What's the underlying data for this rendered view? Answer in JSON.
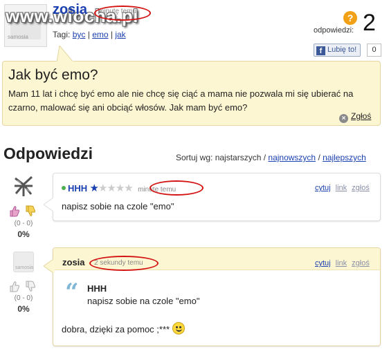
{
  "watermark": "www.wiocha.pl",
  "question": {
    "author": "zosia",
    "time": "minutę temu",
    "tags_label": "Tagi:",
    "tags": [
      "byc",
      "emo",
      "jak"
    ],
    "answers_label": "odpowiedzi:",
    "answers_count": "2",
    "fb_like_label": "Lubię to!",
    "fb_like_count": "0",
    "title": "Jak być emo?",
    "body": "Mam 11 lat i chcę być emo ale nie chcę się ciąć a mama nie pozwala mi się ubierać na czarno, malować się ani obciąć włosów. Jak mam być emo?",
    "report_label": "Zgłoś",
    "avatar_text": "samosia"
  },
  "answers_section": {
    "heading": "Odpowiedzi",
    "sort_label": "Sortuj wg: najstarszych /",
    "sort_options": [
      "najnowszych",
      "najlepszych"
    ]
  },
  "answers": [
    {
      "author": "HHH",
      "time": "minutę temu",
      "rating_stars": 1,
      "rating_max": 5,
      "body": "napisz sobie na czole \"emo\"",
      "actions": [
        "cytuj",
        "link",
        "zgłoś"
      ],
      "score_range": "(0 - 0)",
      "score_pct": "0%"
    },
    {
      "author": "zosia",
      "time": "2 sekundy temu",
      "quote_author": "HHH",
      "quote_text": "napisz sobie na czole \"emo\"",
      "body": "dobra, dzięki za pomoc ;***",
      "actions": [
        "cytuj",
        "link",
        "zgłoś"
      ],
      "score_range": "(0 - 0)",
      "score_pct": "0%",
      "avatar_text": "samosia"
    }
  ],
  "colors": {
    "link": "#1a3fb0",
    "highlight_oval": "#d31212",
    "question_bg": "#fdf6d2",
    "help_icon": "#f2a116",
    "facebook": "#3b5998"
  }
}
